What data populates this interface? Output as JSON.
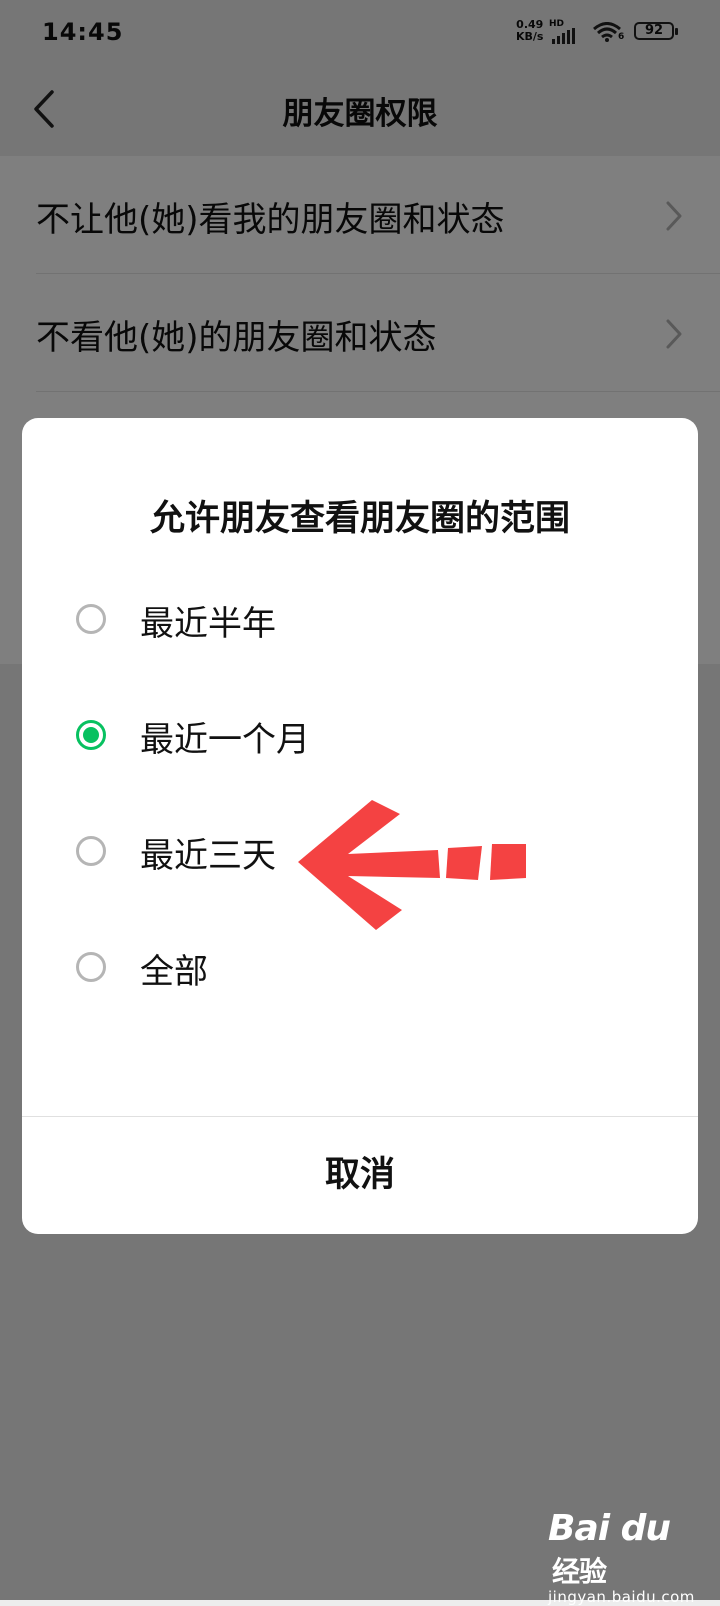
{
  "status_bar": {
    "time": "14:45",
    "net_speed_value": "0.49",
    "net_speed_unit": "KB/s",
    "hd_label": "HD",
    "wifi_num": "6",
    "battery": "92"
  },
  "nav": {
    "back_icon": "chevron-left-icon",
    "title": "朋友圈权限"
  },
  "list": [
    {
      "label": "不让他(她)看我的朋友圈和状态",
      "icon": "chevron-right-icon"
    },
    {
      "label": "不看他(她)的朋友圈和状态",
      "icon": "chevron-right-icon"
    }
  ],
  "dialog": {
    "title": "允许朋友查看朋友圈的范围",
    "options": [
      {
        "label": "最近半年",
        "selected": false
      },
      {
        "label": "最近一个月",
        "selected": true
      },
      {
        "label": "最近三天",
        "selected": false
      },
      {
        "label": "全部",
        "selected": false
      }
    ],
    "cancel": "取消"
  },
  "colors": {
    "accent": "#07c160",
    "annotation_arrow": "#f44242",
    "overlay": "rgba(0,0,0,0.5)"
  },
  "watermark": {
    "logo": "Bai du",
    "suffix": "经验",
    "url": "jingyan.baidu.com"
  }
}
